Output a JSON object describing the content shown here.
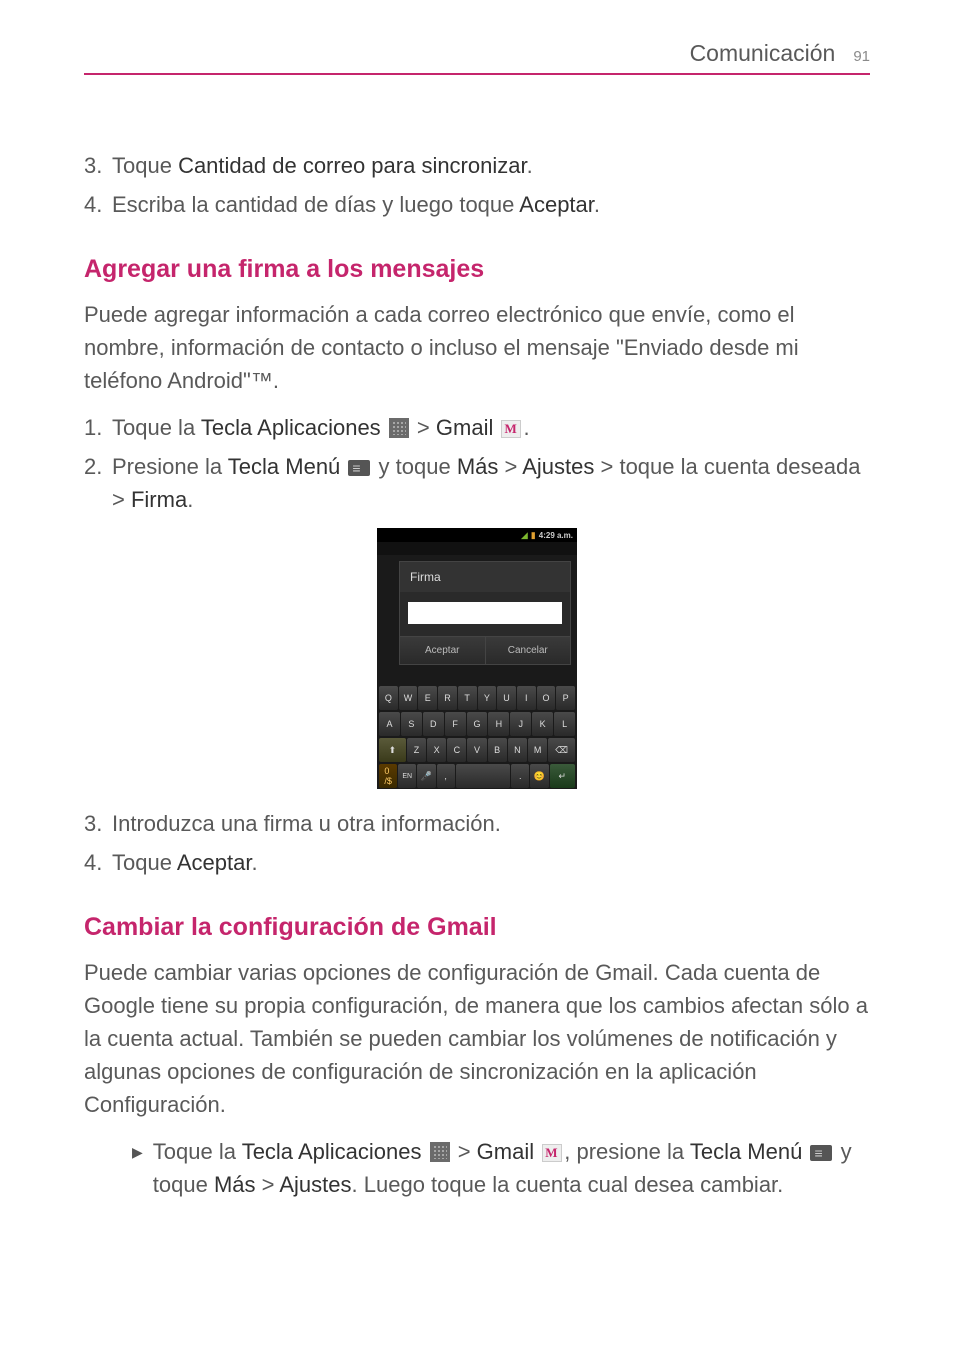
{
  "header": {
    "section": "Comunicación",
    "page": "91"
  },
  "list1": {
    "n3": "3.",
    "t3a": "Toque ",
    "t3b": "Cantidad de correo para sincronizar",
    "t3c": ".",
    "n4": "4.",
    "t4a": "Escriba la cantidad de días y luego toque ",
    "t4b": "Aceptar",
    "t4c": "."
  },
  "h2a": "Agregar una firma a los mensajes",
  "p1": "Puede agregar información a cada correo electrónico que envíe, como el nombre, información de contacto o incluso el mensaje \"Enviado desde mi teléfono Android\"™.",
  "list2": {
    "n1": "1.",
    "t1a": "Toque la ",
    "t1b": "Tecla Aplicaciones",
    "t1c": " > ",
    "t1d": "Gmail",
    "t1e": ".",
    "n2": "2.",
    "t2a": "Presione la ",
    "t2b": "Tecla Menú",
    "t2c": " y toque ",
    "t2d": "Más",
    "t2e": " > ",
    "t2f": "Ajustes",
    "t2g": " > toque la cuenta deseada > ",
    "t2h": "Firma",
    "t2i": ".",
    "n3": "3.",
    "t3": "Introduzca una firma u otra información.",
    "n4": "4.",
    "t4a": "Toque ",
    "t4b": "Aceptar",
    "t4c": "."
  },
  "phone": {
    "time": "4:29 a.m.",
    "faint": "",
    "dialogTitle": "Firma",
    "btnAccept": "Aceptar",
    "btnCancel": "Cancelar",
    "row1": [
      "Q",
      "W",
      "E",
      "R",
      "T",
      "Y",
      "U",
      "I",
      "O",
      "P"
    ],
    "row2": [
      "A",
      "S",
      "D",
      "F",
      "G",
      "H",
      "J",
      "K",
      "L"
    ],
    "row3": [
      "Z",
      "X",
      "C",
      "V",
      "B",
      "N",
      "M"
    ]
  },
  "h2b": "Cambiar la configuración de Gmail",
  "p2": "Puede cambiar varias opciones de configuración de Gmail. Cada cuenta de Google tiene su propia configuración, de manera que los cambios afectan sólo a la cuenta actual. También se pueden cambiar los volúmenes de notificación y algunas opciones de configuración de sincronización en la aplicación Configuración.",
  "bullet": {
    "a": "Toque la ",
    "b": "Tecla Aplicaciones",
    "c": " > ",
    "d": "Gmail",
    "e": ", presione la ",
    "f": "Tecla Menú",
    "g": " y toque ",
    "h": "Más",
    "i": " > ",
    "j": "Ajustes",
    "k": ". Luego toque la cuenta cual desea cambiar."
  }
}
